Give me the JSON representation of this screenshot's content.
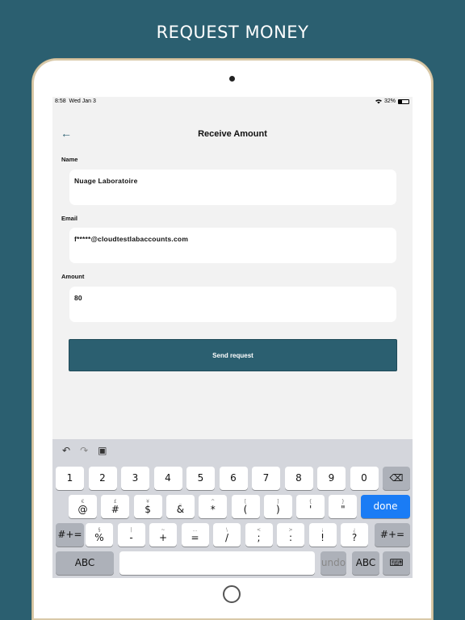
{
  "banner": "REQUEST MONEY",
  "status_bar": {
    "time": "8:58",
    "date": "Wed Jan 3",
    "battery": "32%"
  },
  "header": {
    "title": "Receive Amount",
    "back_icon": "arrow-left-icon"
  },
  "form": {
    "name_label": "Name",
    "name_value": "Nuage Laboratoire",
    "email_label": "Email",
    "email_value": "f*****@cloudtestlabaccounts.com",
    "amount_label": "Amount",
    "amount_value": "80",
    "submit_label": "Send request"
  },
  "colors": {
    "accent": "#2b5f70",
    "keyboard_done": "#1a7cf5"
  },
  "keyboard": {
    "toolbar": [
      "undo-icon",
      "redo-icon",
      "clipboard-icon"
    ],
    "row1": [
      "1",
      "2",
      "3",
      "4",
      "5",
      "6",
      "7",
      "8",
      "9",
      "0"
    ],
    "row2": [
      {
        "sub": "€",
        "main": "@"
      },
      {
        "sub": "£",
        "main": "#"
      },
      {
        "sub": "¥",
        "main": "$"
      },
      {
        "sub": "_",
        "main": "&"
      },
      {
        "sub": "^",
        "main": "*"
      },
      {
        "sub": "[",
        "main": "("
      },
      {
        "sub": "]",
        "main": ")"
      },
      {
        "sub": "{",
        "main": "'"
      },
      {
        "sub": "}",
        "main": "\""
      }
    ],
    "row3": [
      {
        "sub": "§",
        "main": "%"
      },
      {
        "sub": "|",
        "main": "-"
      },
      {
        "sub": "~",
        "main": "+"
      },
      {
        "sub": "…",
        "main": "="
      },
      {
        "sub": "\\",
        "main": "/"
      },
      {
        "sub": "<",
        "main": ";"
      },
      {
        "sub": ">",
        "main": ":"
      },
      {
        "sub": "¡",
        "main": "!"
      },
      {
        "sub": "¿",
        "main": "?"
      }
    ],
    "done_label": "done",
    "symbols_label": "#+=",
    "abc_label": "ABC",
    "undo_label": "undo"
  }
}
